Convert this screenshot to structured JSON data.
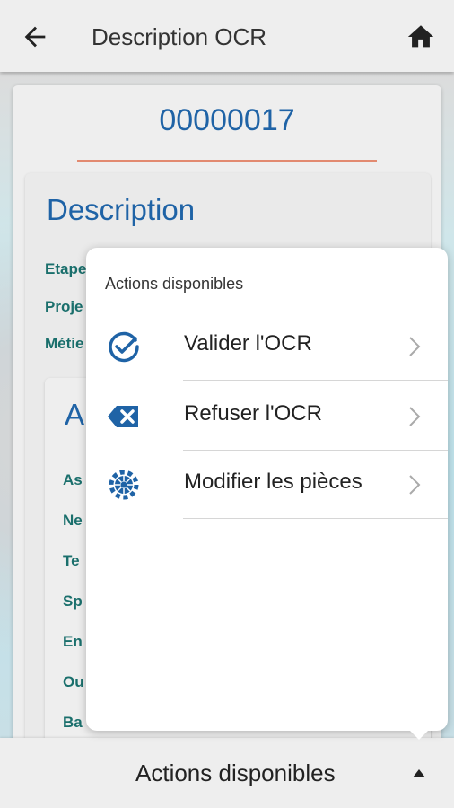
{
  "appbar": {
    "title": "Description OCR",
    "back_icon": "arrow-back-icon",
    "home_icon": "home-icon"
  },
  "card": {
    "number": "00000017"
  },
  "description": {
    "heading": "Description",
    "fields": [
      "Etape",
      "Proje",
      "Métie"
    ]
  },
  "subcard": {
    "heading": "A",
    "fields": [
      "As",
      "Ne",
      "Te",
      "Sp",
      "En",
      "Ou",
      "Ba"
    ]
  },
  "popover": {
    "title": "Actions disponibles",
    "actions": [
      {
        "label": "Valider l'OCR",
        "icon": "check-circle-icon"
      },
      {
        "label": "Refuser l'OCR",
        "icon": "backspace-x-icon"
      },
      {
        "label": "Modifier les pièces",
        "icon": "gear-icon"
      }
    ]
  },
  "bottombar": {
    "label": "Actions disponibles",
    "caret_icon": "caret-up-icon"
  },
  "colors": {
    "accent": "#1f63a6",
    "label": "#1a6f6c",
    "underline": "#e28a70"
  }
}
